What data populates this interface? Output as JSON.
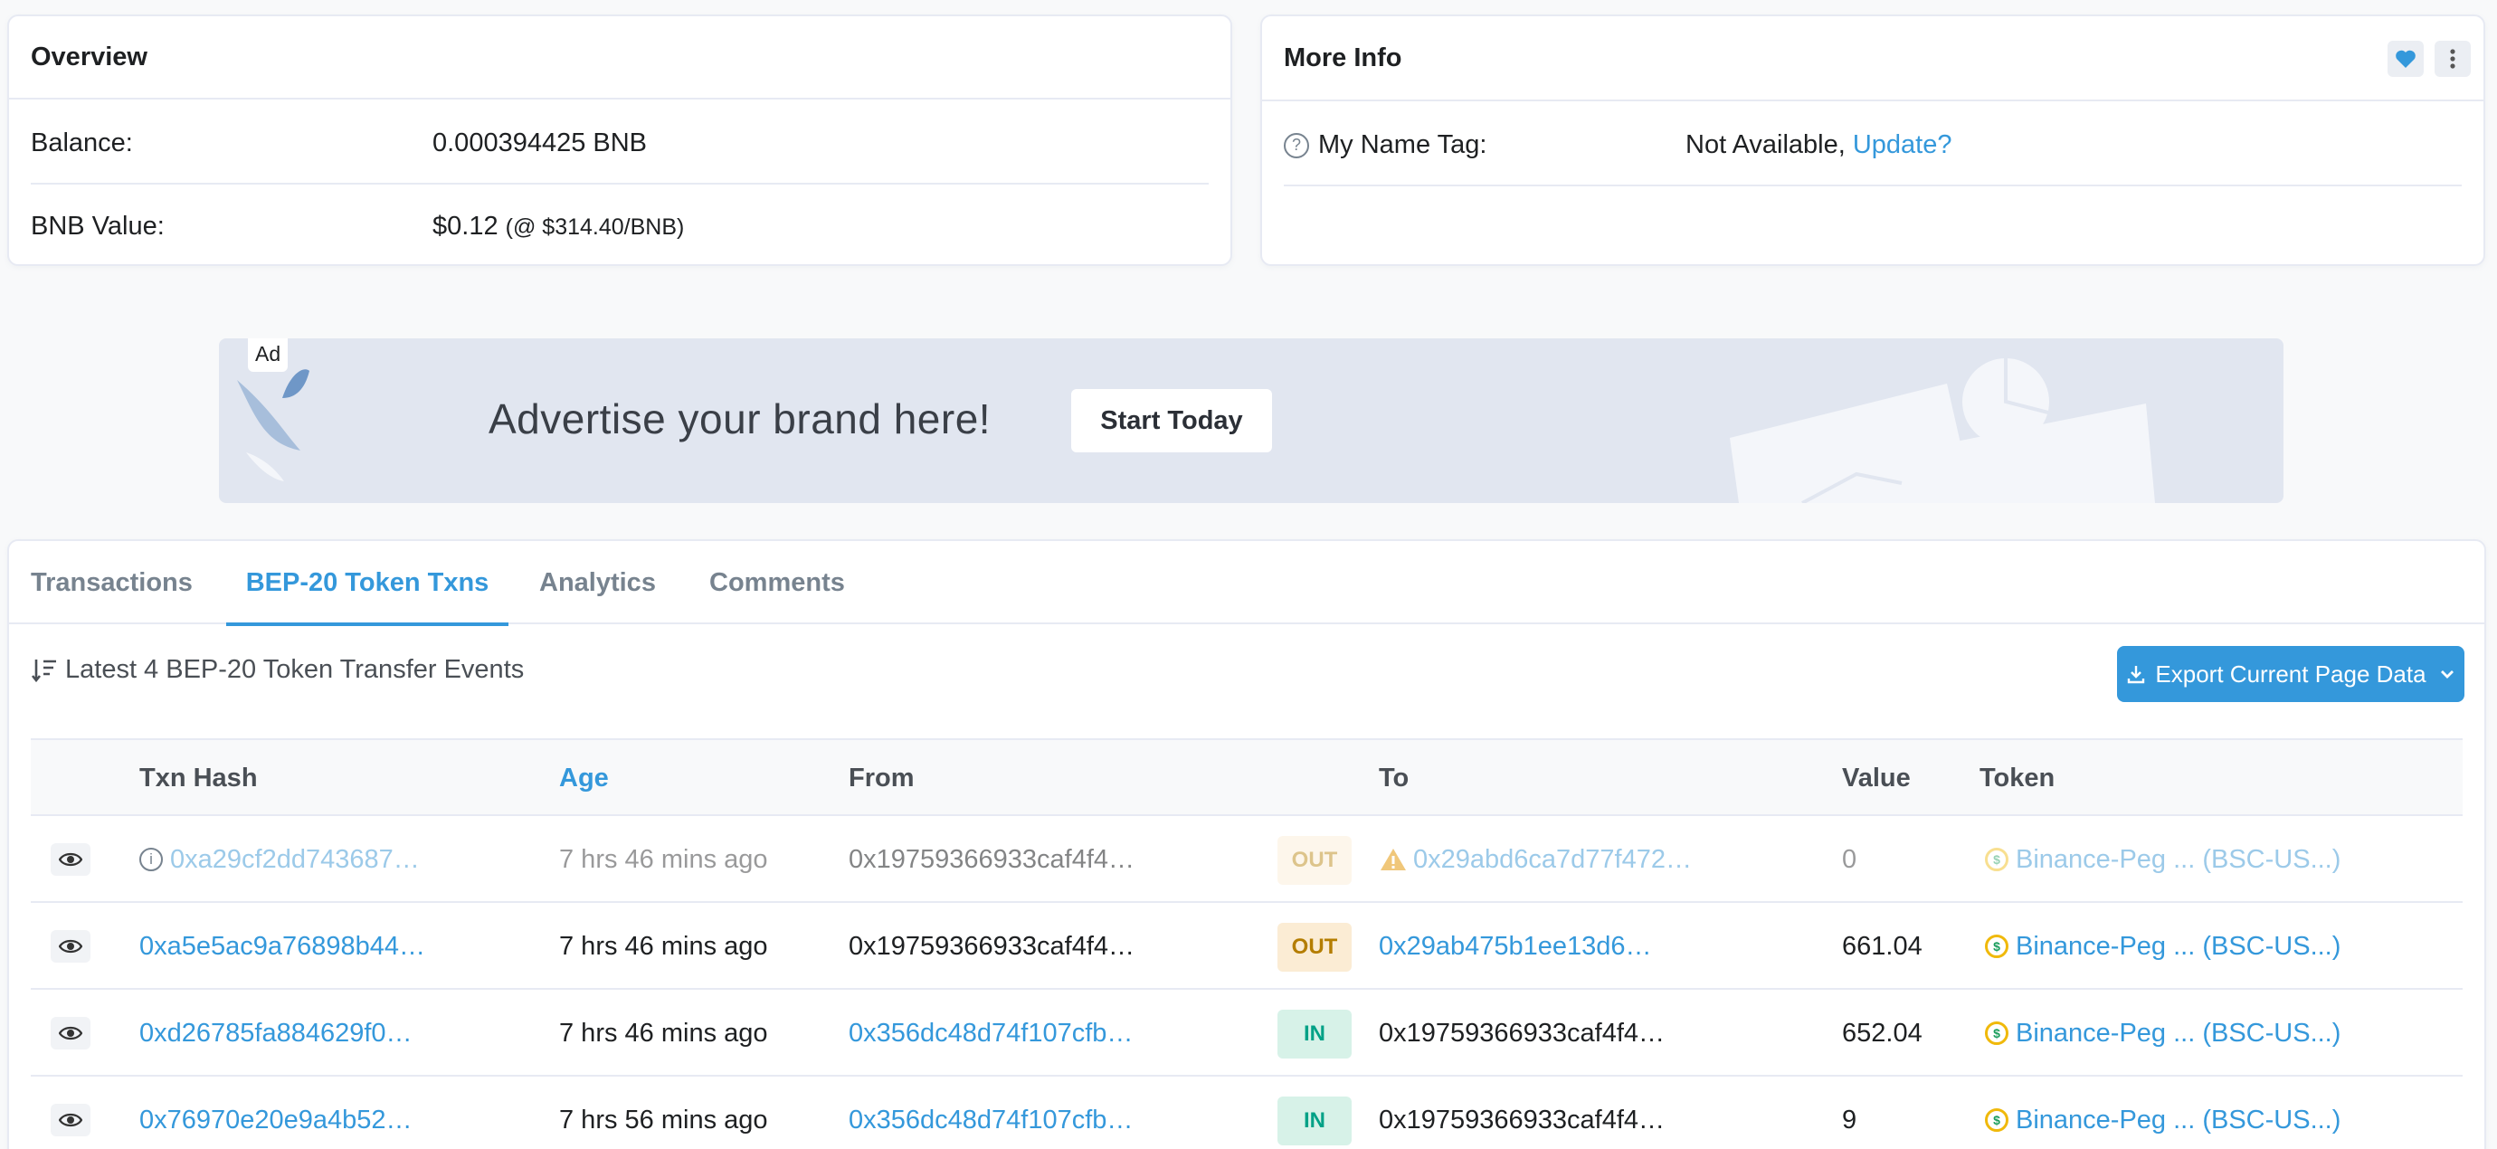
{
  "overview": {
    "title": "Overview",
    "balance_label": "Balance:",
    "balance_value": "0.000394425 BNB",
    "bnb_value_label": "BNB Value:",
    "bnb_value": "$0.12",
    "bnb_price": "(@ $314.40/BNB)"
  },
  "more_info": {
    "title": "More Info",
    "name_tag_label": "My Name Tag:",
    "name_tag_value": "Not Available,",
    "update_link": "Update?"
  },
  "ad": {
    "badge": "Ad",
    "headline": "Advertise your brand here!",
    "cta": "Start Today"
  },
  "tabs": [
    {
      "label": "Transactions"
    },
    {
      "label": "BEP-20 Token Txns"
    },
    {
      "label": "Analytics"
    },
    {
      "label": "Comments"
    }
  ],
  "active_tab": "BEP-20 Token Txns",
  "events": {
    "summary": "Latest 4 BEP-20 Token Transfer Events",
    "export_label": "Export Current Page Data"
  },
  "table": {
    "headers": {
      "txn_hash": "Txn Hash",
      "age": "Age",
      "from": "From",
      "to": "To",
      "value": "Value",
      "token": "Token"
    },
    "rows": [
      {
        "hash": "0xa29cf2dd743687…",
        "age": "7 hrs 46 mins ago",
        "from": "0x19759366933caf4f4…",
        "dir": "OUT",
        "to": "0x29abd6ca7d77f472…",
        "value": "0",
        "token": "Binance-Peg ... (BSC-US...)"
      },
      {
        "hash": "0xa5e5ac9a76898b44…",
        "age": "7 hrs 46 mins ago",
        "from": "0x19759366933caf4f4…",
        "dir": "OUT",
        "to": "0x29ab475b1ee13d6…",
        "value": "661.04",
        "token": "Binance-Peg ... (BSC-US...)"
      },
      {
        "hash": "0xd26785fa884629f0…",
        "age": "7 hrs 46 mins ago",
        "from": "0x356dc48d74f107cfb…",
        "dir": "IN",
        "to": "0x19759366933caf4f4…",
        "value": "652.04",
        "token": "Binance-Peg ... (BSC-US...)"
      },
      {
        "hash": "0x76970e20e9a4b52…",
        "age": "7 hrs 56 mins ago",
        "from": "0x356dc48d74f107cfb…",
        "dir": "IN",
        "to": "0x19759366933caf4f4…",
        "value": "9",
        "token": "Binance-Peg ... (BSC-US...)"
      }
    ]
  },
  "colors": {
    "accent": "#3498db",
    "out_badge": "#fbecd4",
    "in_badge": "#d7f2e8"
  }
}
